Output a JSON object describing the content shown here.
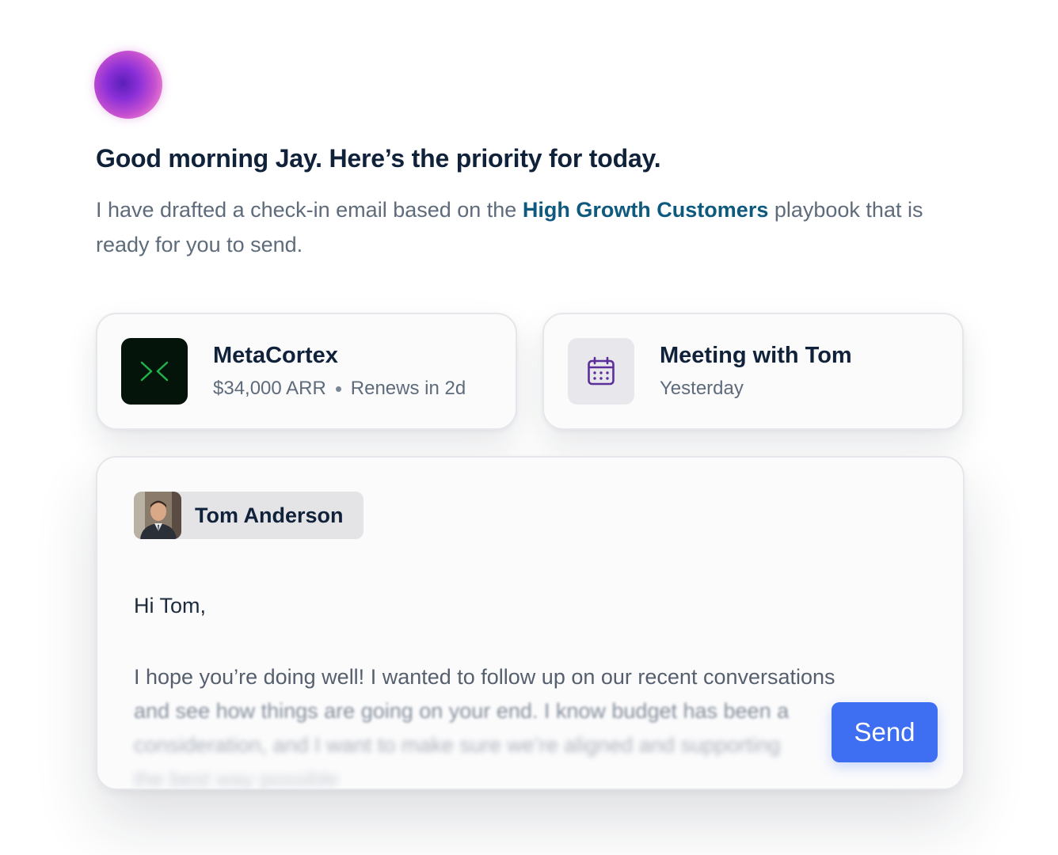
{
  "assistant": {
    "greeting": "Good morning Jay. Here’s the priority for today.",
    "intro_before": "I have drafted a check-in email based on the ",
    "playbook_link": "High Growth Customers",
    "intro_after": " playbook that is ready for you to send."
  },
  "account_card": {
    "name": "MetaCortex",
    "arr": "$34,000 ARR",
    "renewal": "Renews in 2d",
    "logo_icon": "metacortex-logo-icon",
    "logo_bg": "#04140a",
    "logo_color": "#1fb24a"
  },
  "meeting_card": {
    "title": "Meeting with Tom",
    "when": "Yesterday",
    "icon": "calendar-icon",
    "icon_color": "#5b2e9a"
  },
  "email": {
    "recipient": "Tom Anderson",
    "salutation": "Hi Tom,",
    "lines": [
      "I hope you’re doing well! I wanted to follow up on our recent conversations",
      "and see how things are going on your end. I know budget has been a",
      "consideration, and I want to make sure we’re aligned and supporting",
      "the best way possible"
    ],
    "send_label": "Send",
    "send_color": "#3e6ff2"
  }
}
